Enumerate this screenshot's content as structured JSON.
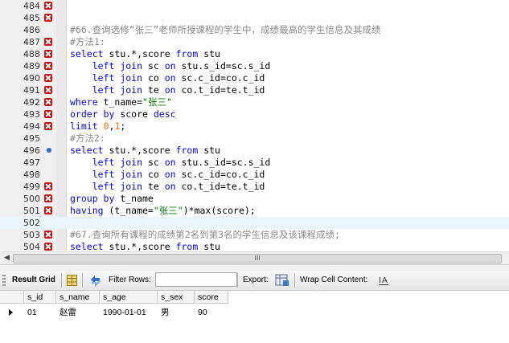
{
  "editor": {
    "lines": [
      {
        "n": "484",
        "marker": "x",
        "tokens": []
      },
      {
        "n": "485",
        "marker": "x",
        "tokens": []
      },
      {
        "n": "486",
        "marker": "",
        "tokens": [
          {
            "t": "#66.查询选修“张三”老师所授课程的学生中，成绩最高的学生信息及其成绩",
            "c": "cm"
          }
        ]
      },
      {
        "n": "487",
        "marker": "x",
        "tokens": [
          {
            "t": "#方法1:",
            "c": "cm"
          }
        ]
      },
      {
        "n": "488",
        "marker": "x",
        "tokens": [
          {
            "t": "select",
            "c": "kw"
          },
          {
            "t": " stu.*,score ",
            "c": ""
          },
          {
            "t": "from",
            "c": "kw"
          },
          {
            "t": " stu",
            "c": ""
          }
        ]
      },
      {
        "n": "489",
        "marker": "x",
        "tokens": [
          {
            "t": "    ",
            "c": ""
          },
          {
            "t": "left join",
            "c": "kw"
          },
          {
            "t": " sc ",
            "c": ""
          },
          {
            "t": "on",
            "c": "kw"
          },
          {
            "t": " stu.s_id=sc.s_id",
            "c": ""
          }
        ]
      },
      {
        "n": "490",
        "marker": "x",
        "tokens": [
          {
            "t": "    ",
            "c": ""
          },
          {
            "t": "left join",
            "c": "kw"
          },
          {
            "t": " co ",
            "c": ""
          },
          {
            "t": "on",
            "c": "kw"
          },
          {
            "t": " sc.c_id=co.c_id",
            "c": ""
          }
        ]
      },
      {
        "n": "491",
        "marker": "x",
        "tokens": [
          {
            "t": "    ",
            "c": ""
          },
          {
            "t": "left join",
            "c": "kw"
          },
          {
            "t": " te ",
            "c": ""
          },
          {
            "t": "on",
            "c": "kw"
          },
          {
            "t": " co.t_id=te.t_id",
            "c": ""
          }
        ]
      },
      {
        "n": "492",
        "marker": "x",
        "tokens": [
          {
            "t": "where",
            "c": "kw"
          },
          {
            "t": " t_name=",
            "c": ""
          },
          {
            "t": "\"张三\"",
            "c": "st"
          }
        ]
      },
      {
        "n": "493",
        "marker": "x",
        "tokens": [
          {
            "t": "order by",
            "c": "kw"
          },
          {
            "t": " score ",
            "c": ""
          },
          {
            "t": "desc",
            "c": "kw"
          }
        ]
      },
      {
        "n": "494",
        "marker": "x",
        "tokens": [
          {
            "t": "limit",
            "c": "kw"
          },
          {
            "t": " ",
            "c": ""
          },
          {
            "t": "0",
            "c": "nu"
          },
          {
            "t": ",",
            "c": ""
          },
          {
            "t": "1",
            "c": "nu"
          },
          {
            "t": ";",
            "c": ""
          }
        ]
      },
      {
        "n": "495",
        "marker": "",
        "tokens": [
          {
            "t": "#方法2:",
            "c": "cm"
          }
        ]
      },
      {
        "n": "496",
        "marker": "dot",
        "tokens": [
          {
            "t": "select",
            "c": "kw"
          },
          {
            "t": " stu.*,score ",
            "c": ""
          },
          {
            "t": "from",
            "c": "kw"
          },
          {
            "t": " stu",
            "c": ""
          }
        ]
      },
      {
        "n": "497",
        "marker": "",
        "tokens": [
          {
            "t": "    ",
            "c": ""
          },
          {
            "t": "left join",
            "c": "kw"
          },
          {
            "t": " sc ",
            "c": ""
          },
          {
            "t": "on",
            "c": "kw"
          },
          {
            "t": " stu.s_id=sc.s_id",
            "c": ""
          }
        ]
      },
      {
        "n": "498",
        "marker": "",
        "tokens": [
          {
            "t": "    ",
            "c": ""
          },
          {
            "t": "left join",
            "c": "kw"
          },
          {
            "t": " co ",
            "c": ""
          },
          {
            "t": "on",
            "c": "kw"
          },
          {
            "t": " sc.c_id=co.c_id",
            "c": ""
          }
        ]
      },
      {
        "n": "499",
        "marker": "x",
        "tokens": [
          {
            "t": "    ",
            "c": ""
          },
          {
            "t": "left join",
            "c": "kw"
          },
          {
            "t": " te ",
            "c": ""
          },
          {
            "t": "on",
            "c": "kw"
          },
          {
            "t": " co.t_id=te.t_id",
            "c": ""
          }
        ]
      },
      {
        "n": "500",
        "marker": "x",
        "tokens": [
          {
            "t": "group by",
            "c": "kw"
          },
          {
            "t": " t_name",
            "c": ""
          }
        ]
      },
      {
        "n": "501",
        "marker": "x",
        "tokens": [
          {
            "t": "having",
            "c": "kw"
          },
          {
            "t": " (t_name=",
            "c": ""
          },
          {
            "t": "\"张三\"",
            "c": "st"
          },
          {
            "t": ")*max(score);",
            "c": ""
          }
        ]
      },
      {
        "n": "502",
        "marker": "",
        "current": true,
        "tokens": []
      },
      {
        "n": "503",
        "marker": "x",
        "tokens": [
          {
            "t": "#67.查询所有课程的成绩第2名到第3名的学生信息及该课程成绩;",
            "c": "cm"
          }
        ]
      },
      {
        "n": "504",
        "marker": "x",
        "tokens": [
          {
            "t": "select",
            "c": "kw"
          },
          {
            "t": " stu.*,score ",
            "c": ""
          },
          {
            "t": "from",
            "c": "kw"
          },
          {
            "t": " stu",
            "c": ""
          }
        ]
      }
    ]
  },
  "scrollbar": {
    "left_arrow": "◀",
    "grip": "III"
  },
  "toolbar": {
    "result_grid": "Result Grid",
    "filter_rows": "Filter Rows:",
    "filter_value": "",
    "export": "Export:",
    "wrap_cell": "Wrap Cell Content:"
  },
  "grid": {
    "columns": [
      "s_id",
      "s_name",
      "s_age",
      "s_sex",
      "score"
    ],
    "rows": [
      [
        "01",
        "赵雷",
        "1990-01-01",
        "男",
        "90"
      ]
    ]
  },
  "icons": {
    "error_marker": "error-x-icon",
    "breakpoint": "blue-dot-icon",
    "grid_view": "grid-view-icon",
    "refresh": "refresh-icon",
    "export": "export-icon",
    "wrap": "wrap-text-icon"
  }
}
